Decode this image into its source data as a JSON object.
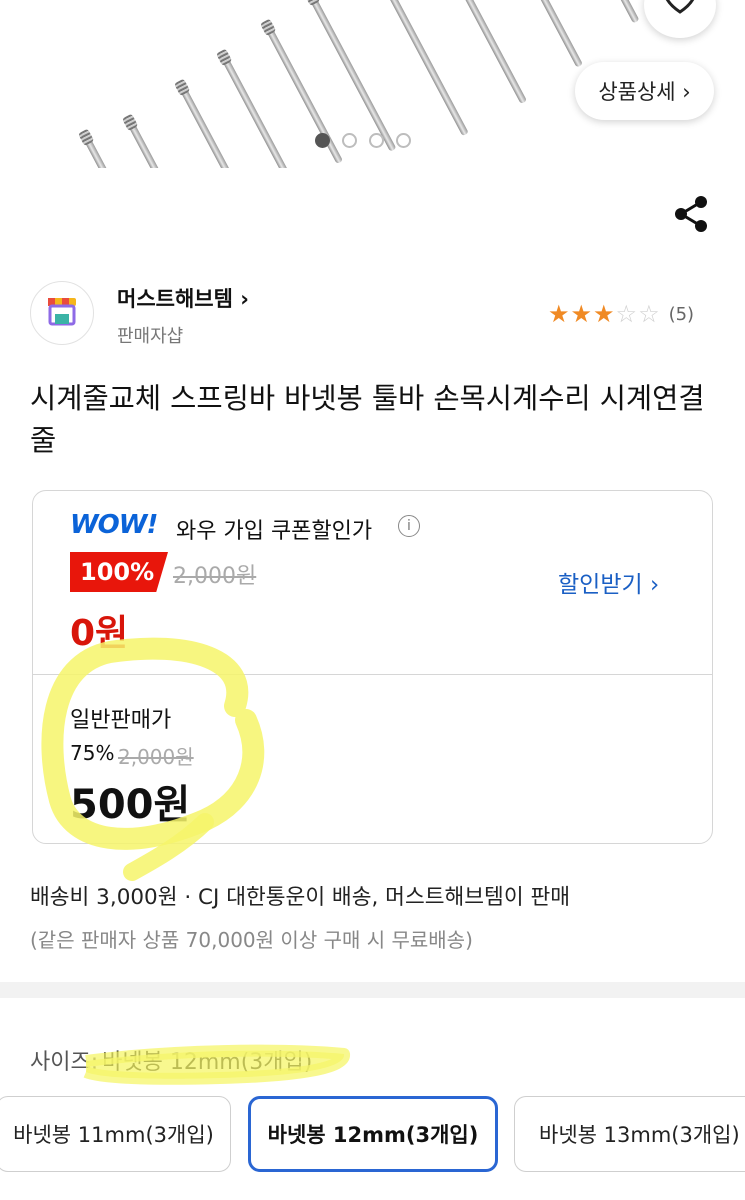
{
  "hero": {
    "detail_button": "상품상세 ›",
    "carousel_total": 4,
    "carousel_active": 1
  },
  "seller": {
    "name": "머스트해브템 ›",
    "subtitle": "판매자샵",
    "rating": 3,
    "rating_max": 5,
    "review_count": "(5)"
  },
  "product": {
    "title": "시계줄교체 스프링바 바넷봉 툴바 손목시계수리 시계연결줄"
  },
  "price": {
    "wow_logo": "WOW!",
    "wow_label": "와우 가입 쿠폰할인가",
    "wow_badge": "100%",
    "wow_original": "2,000원",
    "wow_price": "0원",
    "discount_link": "할인받기 ›",
    "normal_label": "일반판매가",
    "normal_pct": "75%",
    "normal_original": "2,000원",
    "normal_price": "500원"
  },
  "shipping": {
    "line1": "배송비 3,000원 · CJ 대한통운이 배송, 머스트해브템이 판매",
    "line2": "(같은 판매자 상품 70,000원 이상 구매 시 무료배송)"
  },
  "options": {
    "label": "사이즈:",
    "selected_value": "바넷봉 12mm(3개입)",
    "items": [
      {
        "label": "바넷봉 11mm(3개입)"
      },
      {
        "label": "바넷봉 12mm(3개입)"
      },
      {
        "label": "바넷봉 13mm(3개입)"
      }
    ]
  },
  "colors": {
    "accent_blue": "#2a66d3",
    "sale_red": "#e8160b",
    "star_orange": "#f08a24",
    "highlighter": "#f6f56a"
  }
}
